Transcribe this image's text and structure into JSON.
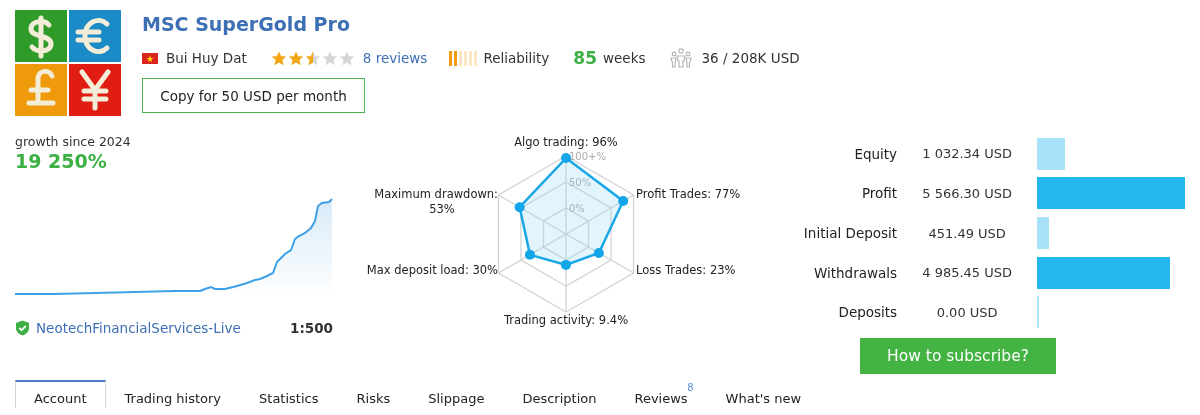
{
  "signal": {
    "title": "MSC SuperGold Pro",
    "author": "Bui Huy Dat",
    "stars": 2.5,
    "reviews_link": "8 reviews",
    "reliability": {
      "label": "Reliability",
      "level": 0.33
    },
    "weeks": {
      "value": "85",
      "unit": "weeks"
    },
    "subscribers": "36 / 208K USD",
    "copy_button": "Copy for 50 USD per month"
  },
  "growth": {
    "caption": "growth since 2024",
    "value": "19 250%",
    "broker": "NeotechFinancialServices-Live",
    "leverage": "1:500"
  },
  "radar": {
    "ring_labels": [
      "100+%",
      "50%",
      "0%"
    ],
    "axes": [
      {
        "label": "Algo trading: 96%"
      },
      {
        "label": "Maximum drawdown:",
        "label_2": "53%"
      },
      {
        "label": "Profit Trades: 77%"
      },
      {
        "label": "Max deposit load: 30%"
      },
      {
        "label": "Loss Trades: 23%"
      },
      {
        "label": "Trading activity: 9.4%"
      }
    ]
  },
  "balances": [
    {
      "label": "Equity",
      "value": "1 032.34 USD",
      "color": "#a8e2f8"
    },
    {
      "label": "Profit",
      "value": "5 566.30 USD",
      "color": "#22b8ee"
    },
    {
      "label": "Initial Deposit",
      "value": "451.49 USD",
      "color": "#a8e2f8"
    },
    {
      "label": "Withdrawals",
      "value": "4 985.45 USD",
      "color": "#22b8ee"
    },
    {
      "label": "Deposits",
      "value": "0.00 USD",
      "color": "#a8e2f8"
    }
  ],
  "subscribe_button": "How to subscribe?",
  "tabs": [
    {
      "label": "Account",
      "selected": true
    },
    {
      "label": "Trading history",
      "selected": false
    },
    {
      "label": "Statistics",
      "selected": false
    },
    {
      "label": "Risks",
      "selected": false
    },
    {
      "label": "Slippage",
      "selected": false
    },
    {
      "label": "Description",
      "selected": false
    },
    {
      "label": "Reviews",
      "badge": "8",
      "selected": false
    },
    {
      "label": "What's new",
      "selected": false
    }
  ]
}
